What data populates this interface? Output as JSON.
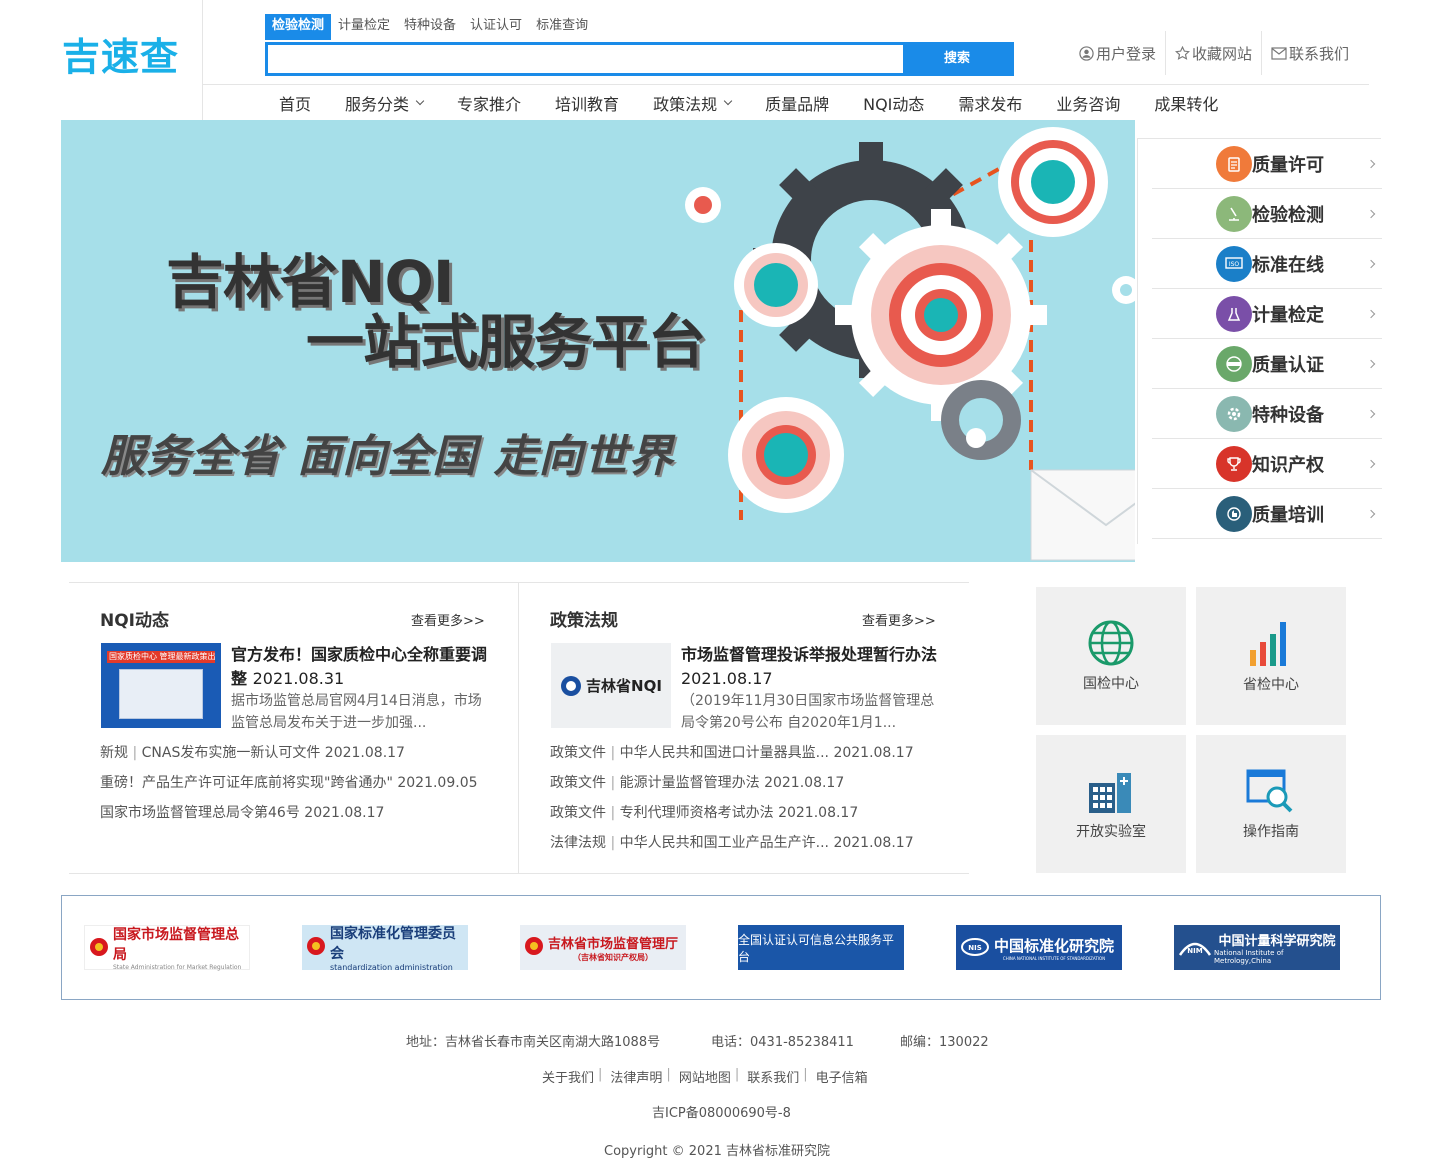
{
  "logo": "吉速查",
  "search": {
    "tabs": [
      "检验检测",
      "计量检定",
      "特种设备",
      "认证认可",
      "标准查询"
    ],
    "active_tab": 0,
    "placeholder": "",
    "button": "搜索"
  },
  "top_links": [
    "用户登录",
    "收藏网站",
    "联系我们"
  ],
  "nav": [
    {
      "label": "首页",
      "dropdown": false
    },
    {
      "label": "服务分类",
      "dropdown": true
    },
    {
      "label": "专家推介",
      "dropdown": false
    },
    {
      "label": "培训教育",
      "dropdown": false
    },
    {
      "label": "政策法规",
      "dropdown": true
    },
    {
      "label": "质量品牌",
      "dropdown": false
    },
    {
      "label": "NQI动态",
      "dropdown": false
    },
    {
      "label": "需求发布",
      "dropdown": false
    },
    {
      "label": "业务咨询",
      "dropdown": false
    },
    {
      "label": "成果转化",
      "dropdown": false
    }
  ],
  "banner": {
    "title1": "吉林省NQI",
    "title2": "一站式服务平台",
    "slogan": "服务全省  面向全国  走向世界"
  },
  "side_menu": [
    {
      "label": "质量许可",
      "icon": "clipboard-icon",
      "color": "#f07a3a"
    },
    {
      "label": "检验检测",
      "icon": "microscope-icon",
      "color": "#8cb87a"
    },
    {
      "label": "标准在线",
      "icon": "iso-icon",
      "color": "#1a7fc8"
    },
    {
      "label": "计量检定",
      "icon": "flask-icon",
      "color": "#7a4fa8"
    },
    {
      "label": "质量认证",
      "icon": "passed-icon",
      "color": "#6aa86a"
    },
    {
      "label": "特种设备",
      "icon": "gear-icon",
      "color": "#8ab8b0"
    },
    {
      "label": "知识产权",
      "icon": "trophy-icon",
      "color": "#d8342a"
    },
    {
      "label": "质量培训",
      "icon": "hand-icon",
      "color": "#2a5f7a"
    }
  ],
  "nqi": {
    "title": "NQI动态",
    "more": "查看更多>>",
    "thumb_text": "国家质检中心 管理最新政策出台",
    "featured_title": "官方发布！国家质检中心全称重要调整",
    "featured_date": "2021.08.31",
    "featured_desc": "据市场监管总局官网4月14日消息，市场监管总局发布关于进一步加强...",
    "items": [
      {
        "cat": "新规",
        "text": "CNAS发布实施一新认可文件",
        "date": "2021.08.17"
      },
      {
        "cat": "",
        "text": "重磅！产品生产许可证年底前将实现\"跨省通办\"",
        "date": "2021.09.05"
      },
      {
        "cat": "",
        "text": "国家市场监督管理总局令第46号",
        "date": "2021.08.17"
      }
    ]
  },
  "policy": {
    "title": "政策法规",
    "more": "查看更多>>",
    "thumb_text": "吉林省NQI",
    "featured_title": "市场监督管理投诉举报处理暂行办法",
    "featured_date": "2021.08.17",
    "featured_desc": "（2019年11月30日国家市场监督管理总局令第20号公布 自2020年1月1...",
    "items": [
      {
        "cat": "政策文件",
        "text": "中华人民共和国进口计量器具监...",
        "date": "2021.08.17"
      },
      {
        "cat": "政策文件",
        "text": "能源计量监督管理办法",
        "date": "2021.08.17"
      },
      {
        "cat": "政策文件",
        "text": "专利代理师资格考试办法",
        "date": "2021.08.17"
      },
      {
        "cat": "法律法规",
        "text": "中华人民共和国工业产品生产许...",
        "date": "2021.08.17"
      }
    ]
  },
  "tiles": [
    {
      "label": "国检中心",
      "icon": "globe-icon"
    },
    {
      "label": "省检中心",
      "icon": "bar-chart-icon"
    },
    {
      "label": "开放实验室",
      "icon": "building-icon"
    },
    {
      "label": "操作指南",
      "icon": "magnifier-icon"
    }
  ],
  "partners": [
    {
      "label": "国家市场监督管理总局",
      "sub": "State Administration for Market Regulation",
      "bg": "#ffffff",
      "color": "#c8181e"
    },
    {
      "label": "国家标准化管理委员会",
      "sub": "standardization administration",
      "bg": "#cfe6f4",
      "color": "#1a3e7a"
    },
    {
      "label": "吉林省市场监督管理厅",
      "sub": "（吉林省知识产权局）",
      "bg": "#e9eef4",
      "color": "#c8181e"
    },
    {
      "label": "全国认证认可信息公共服务平台",
      "sub": "",
      "bg": "#1a56a8",
      "color": "#ffffff"
    },
    {
      "label": "中国标准化研究院",
      "sub": "CHINA NATIONAL INSTITUTE OF STANDARDIZATION",
      "bg": "#1a4fa0",
      "color": "#ffffff"
    },
    {
      "label": "中国计量科学研究院",
      "sub": "National Institute of Metrology,China",
      "bg": "#24508e",
      "color": "#ffffff"
    }
  ],
  "footer": {
    "address": "地址：吉林省长春市南关区南湖大路1088号",
    "phone": "电话：0431-85238411",
    "postcode": "邮编：130022",
    "links": [
      "关于我们",
      "法律声明",
      "网站地图",
      "联系我们",
      "电子信箱"
    ],
    "icp": "吉ICP备08000690号-8",
    "copyright": "Copyright © 2021 吉林省标准研究院"
  }
}
